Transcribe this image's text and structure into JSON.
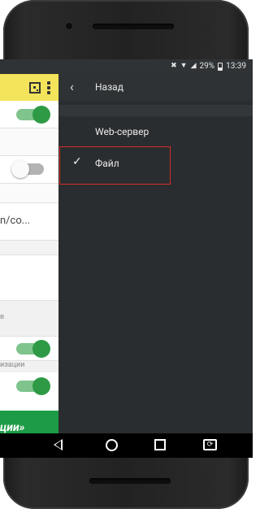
{
  "status_bar": {
    "icons": [
      "mute-icon",
      "wifi-icon",
      "signal-icon"
    ],
    "battery_percent": "29%",
    "time": "13:39"
  },
  "underlying_app": {
    "address_text": "n/co...",
    "section_label_1": "в",
    "section_label_2": "изации",
    "bottom_button_label": "ции»",
    "colors": {
      "toolbar": "#f4e45b",
      "accent_green": "#1e9b46"
    }
  },
  "drawer": {
    "back_label": "Назад",
    "items": [
      {
        "label": "Web-сервер",
        "checked": false
      },
      {
        "label": "Файл",
        "checked": true
      }
    ],
    "highlight_color": "#d62b2b"
  },
  "nav_bar": {
    "buttons": [
      "back-icon",
      "home-icon",
      "recents-icon",
      "rotate-icon"
    ]
  }
}
